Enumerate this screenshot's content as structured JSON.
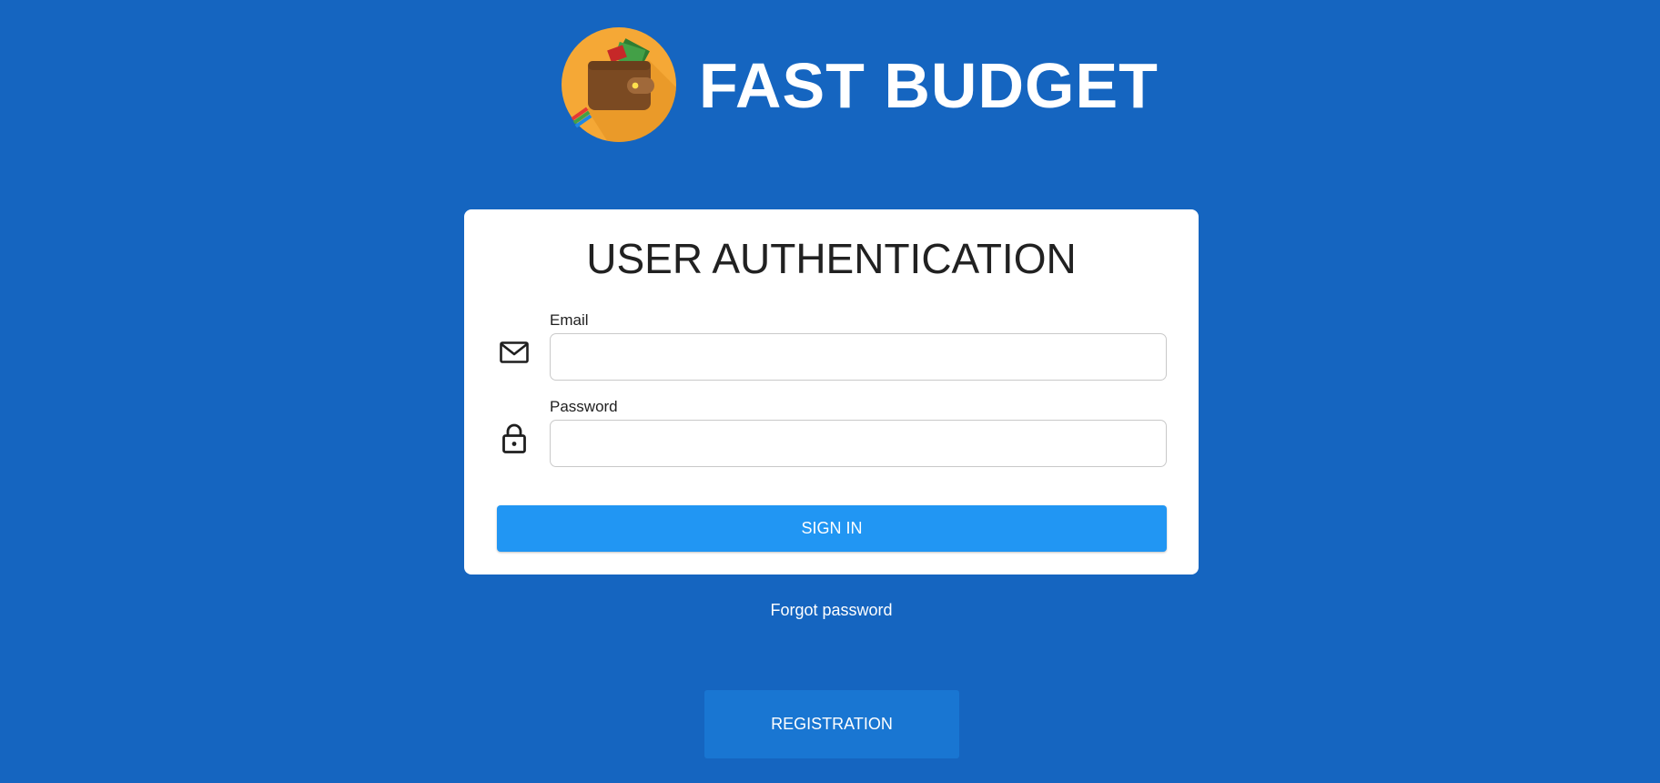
{
  "app": {
    "title": "FAST BUDGET",
    "logo_icon": "wallet-icon"
  },
  "auth_card": {
    "title": "USER AUTHENTICATION",
    "email": {
      "label": "Email",
      "value": "",
      "placeholder": "",
      "icon": "mail-icon"
    },
    "password": {
      "label": "Password",
      "value": "",
      "placeholder": "",
      "icon": "lock-icon"
    },
    "signin_label": "SIGN IN"
  },
  "forgot_password_label": "Forgot password",
  "registration_label": "REGISTRATION",
  "colors": {
    "background": "#1565c0",
    "card": "#ffffff",
    "primary_button": "#2196f3",
    "secondary_button": "#1976d2",
    "logo_circle": "#f9a825",
    "wallet": "#7b4a22"
  }
}
